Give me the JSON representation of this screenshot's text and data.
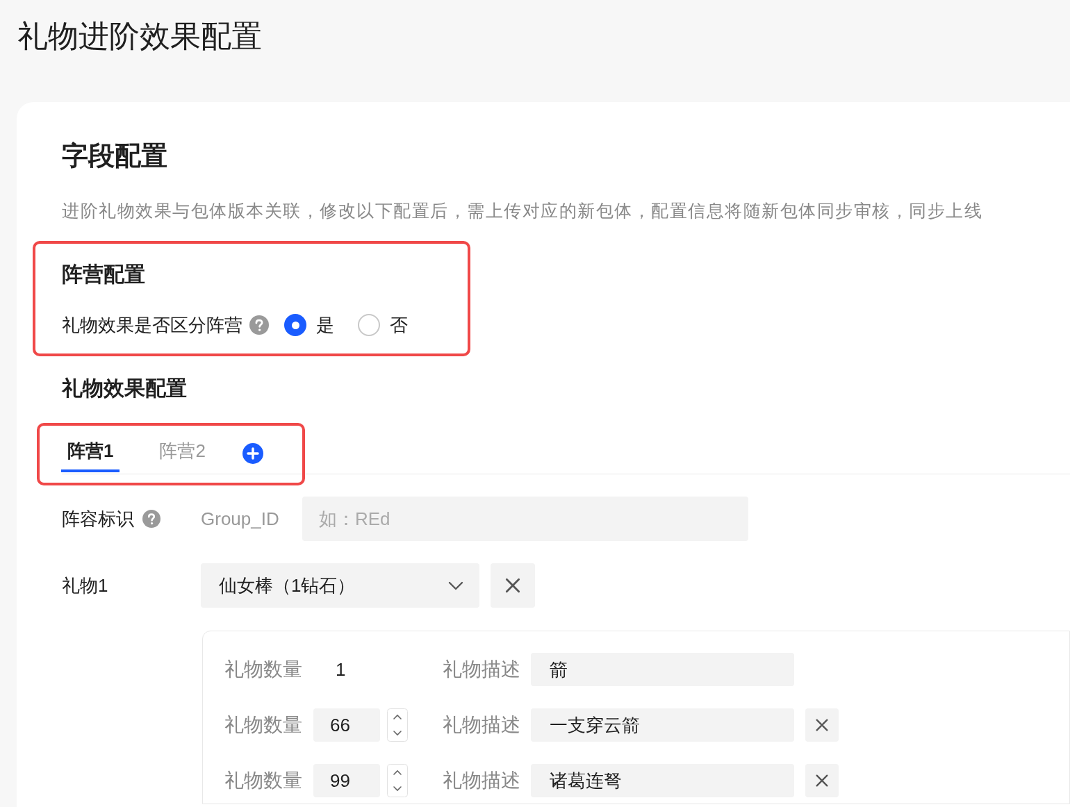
{
  "page_title": "礼物进阶效果配置",
  "section": {
    "title": "字段配置",
    "description": "进阶礼物效果与包体版本关联，修改以下配置后，需上传对应的新包体，配置信息将随新包体同步审核，同步上线"
  },
  "camp_config": {
    "title": "阵营配置",
    "question": "礼物效果是否区分阵营",
    "options": [
      {
        "label": "是",
        "selected": true
      },
      {
        "label": "否",
        "selected": false
      }
    ]
  },
  "gift_effects": {
    "title": "礼物效果配置",
    "tabs": [
      {
        "label": "阵营1",
        "selected": true
      },
      {
        "label": "阵营2",
        "selected": false
      }
    ],
    "group": {
      "label": "阵容标识",
      "prefix": "Group_ID",
      "placeholder": "如：REd"
    },
    "gifts": [
      {
        "label": "礼物1",
        "value": "仙女棒（1钻石）",
        "tiers": [
          {
            "kind": "fixed",
            "quantity_label": "礼物数量",
            "quantity": "1",
            "description_label": "礼物描述",
            "description": "箭"
          },
          {
            "kind": "editable",
            "quantity_label": "礼物数量",
            "quantity": "66",
            "description_label": "礼物描述",
            "description": "一支穿云箭"
          },
          {
            "kind": "editable",
            "quantity_label": "礼物数量",
            "quantity": "99",
            "description_label": "礼物描述",
            "description": "诸葛连弩"
          }
        ]
      }
    ]
  }
}
